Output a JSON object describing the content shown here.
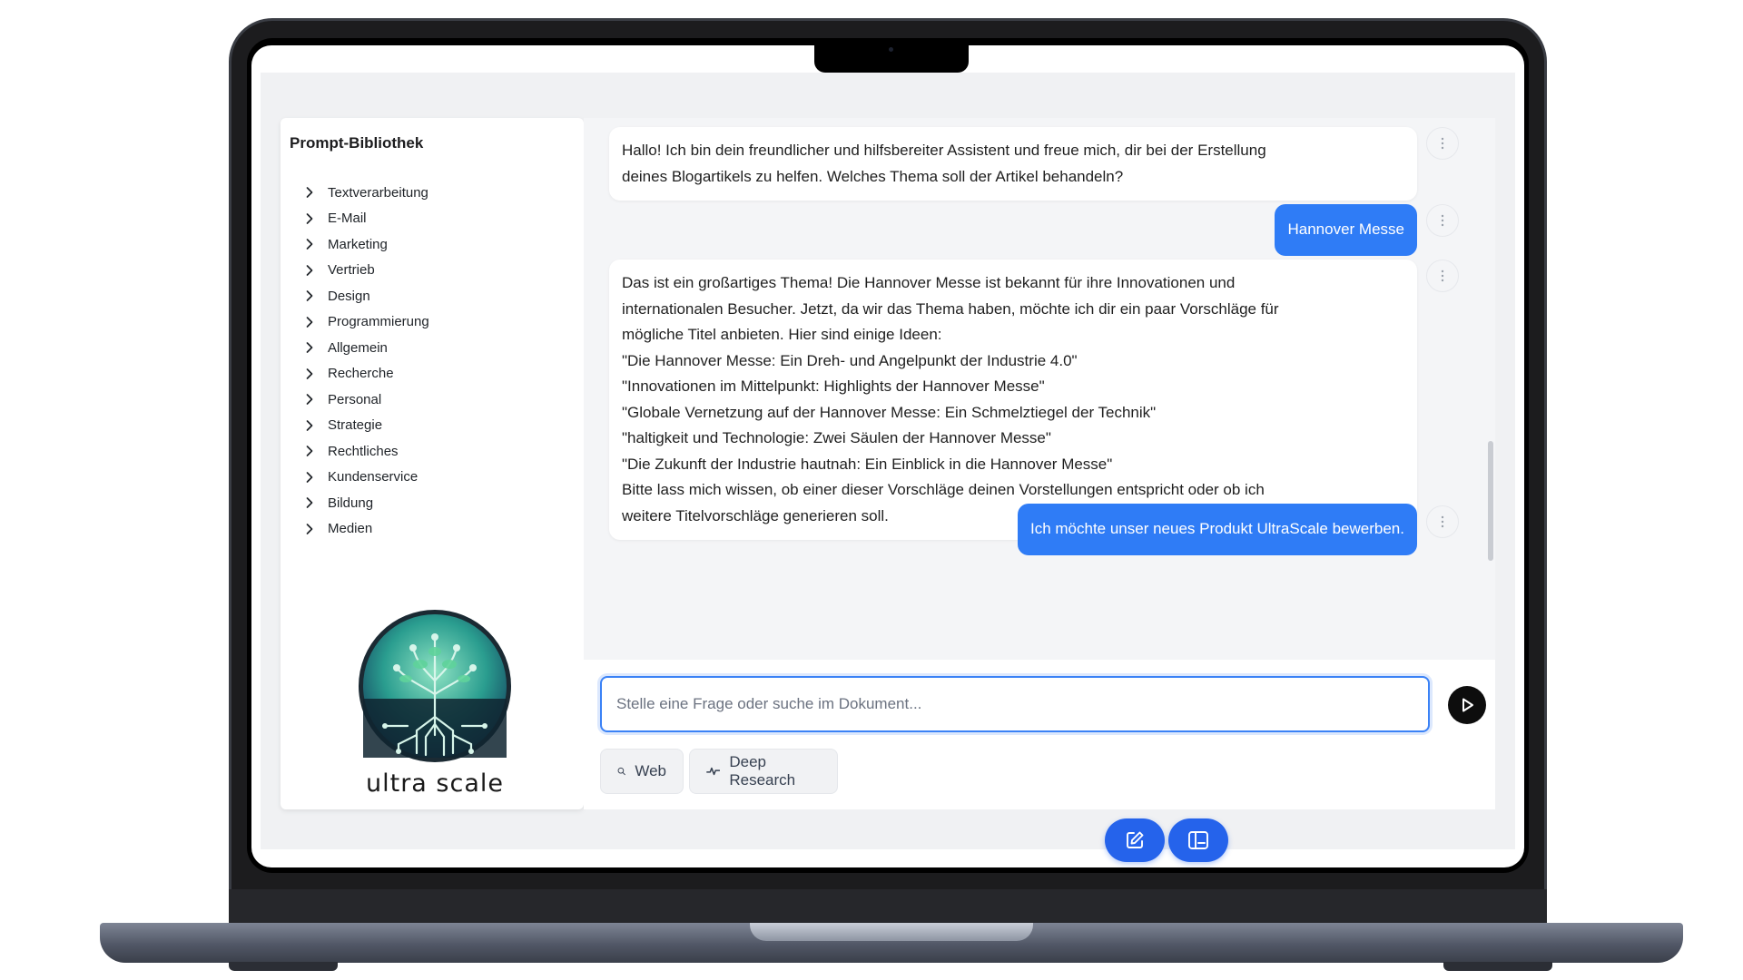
{
  "sidebar": {
    "title": "Prompt-Bibliothek",
    "categories": [
      "Textverarbeitung",
      "E-Mail",
      "Marketing",
      "Vertrieb",
      "Design",
      "Programmierung",
      "Allgemein",
      "Recherche",
      "Personal",
      "Strategie",
      "Rechtliches",
      "Kundenservice",
      "Bildung",
      "Medien"
    ],
    "logo_text": "ultra scale"
  },
  "chat": {
    "messages": [
      {
        "role": "assistant",
        "lines": [
          "Hallo! Ich bin dein freundlicher und hilfsbereiter Assistent und freue mich, dir bei der Erstellung",
          "deines Blogartikels zu helfen. Welches Thema soll der Artikel behandeln?"
        ]
      },
      {
        "role": "user",
        "lines": [
          "Hannover Messe"
        ]
      },
      {
        "role": "assistant",
        "lines": [
          "Das ist ein großartiges Thema! Die Hannover Messe ist bekannt für ihre Innovationen und",
          "internationalen Besucher. Jetzt, da wir das Thema haben, möchte ich dir ein paar Vorschläge für",
          "mögliche Titel anbieten. Hier sind einige Ideen:",
          "\"Die Hannover Messe: Ein Dreh- und Angelpunkt der Industrie 4.0\"",
          "\"Innovationen im Mittelpunkt: Highlights der Hannover Messe\"",
          "\"Globale Vernetzung auf der Hannover Messe: Ein Schmelztiegel der Technik\"",
          "\"haltigkeit und Technologie: Zwei Säulen der Hannover Messe\"",
          "\"Die Zukunft der Industrie hautnah: Ein Einblick in die Hannover Messe\"",
          "Bitte lass mich wissen, ob einer dieser Vorschläge deinen Vorstellungen entspricht oder ob ich",
          "weitere Titelvorschläge generieren soll."
        ]
      },
      {
        "role": "user",
        "lines": [
          "Ich möchte unser neues Produkt UltraScale bewerben."
        ]
      }
    ]
  },
  "composer": {
    "placeholder": "Stelle eine Frage oder suche im Dokument...",
    "value": "",
    "web_label": "Web",
    "deep_research_label": "Deep Research"
  },
  "colors": {
    "accent": "#2f7cf6",
    "fab": "#2563eb",
    "send": "#0d0d0d"
  },
  "icons": {
    "category": "chevron-right-icon",
    "more": "more-vertical-icon",
    "send": "play-icon",
    "web": "search-icon",
    "deep_research": "activity-icon",
    "new_chat": "edit-icon",
    "sidebar": "book-icon"
  }
}
